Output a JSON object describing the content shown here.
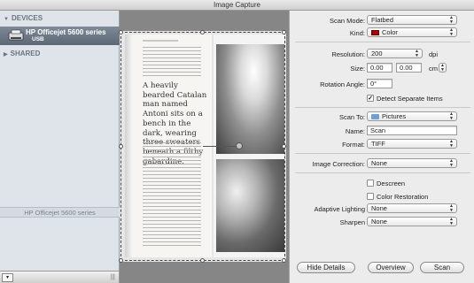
{
  "window": {
    "title": "Image Capture"
  },
  "sidebar": {
    "devices_header": "DEVICES",
    "device": {
      "name": "HP Officejet 5600 series",
      "connection": "USB"
    },
    "shared_header": "SHARED",
    "footer_label": "HP Officejet 5600 series"
  },
  "preview": {
    "left_page_text": "A heavily bearded Catalan man named Antoni sits on a bench in the dark, wearing three sweaters beneath a filthy gabardine."
  },
  "settings": {
    "scan_mode": {
      "label": "Scan Mode:",
      "value": "Flatbed"
    },
    "kind": {
      "label": "Kind:",
      "value": "Color",
      "swatch_color": "#aa0000"
    },
    "resolution": {
      "label": "Resolution:",
      "value": "200",
      "unit": "dpi"
    },
    "size": {
      "label": "Size:",
      "width": "0.00",
      "height": "0.00",
      "unit": "cm"
    },
    "rotation": {
      "label": "Rotation Angle:",
      "value": "0°"
    },
    "detect_separate": {
      "label": "Detect Separate Items",
      "checked": true
    },
    "scan_to": {
      "label": "Scan To:",
      "value": "Pictures"
    },
    "name": {
      "label": "Name:",
      "value": "Scan"
    },
    "format": {
      "label": "Format:",
      "value": "TIFF"
    },
    "image_correction": {
      "label": "Image Correction:",
      "value": "None"
    },
    "descreen": {
      "label": "Descreen",
      "checked": false
    },
    "color_restoration": {
      "label": "Color Restoration",
      "checked": false
    },
    "adaptive_lighting": {
      "label": "Adaptive Lighting",
      "value": "None"
    },
    "sharpen": {
      "label": "Sharpen",
      "value": "None"
    }
  },
  "buttons": {
    "hide_details": "Hide Details",
    "overview": "Overview",
    "scan": "Scan"
  },
  "check_glyph": "✓"
}
